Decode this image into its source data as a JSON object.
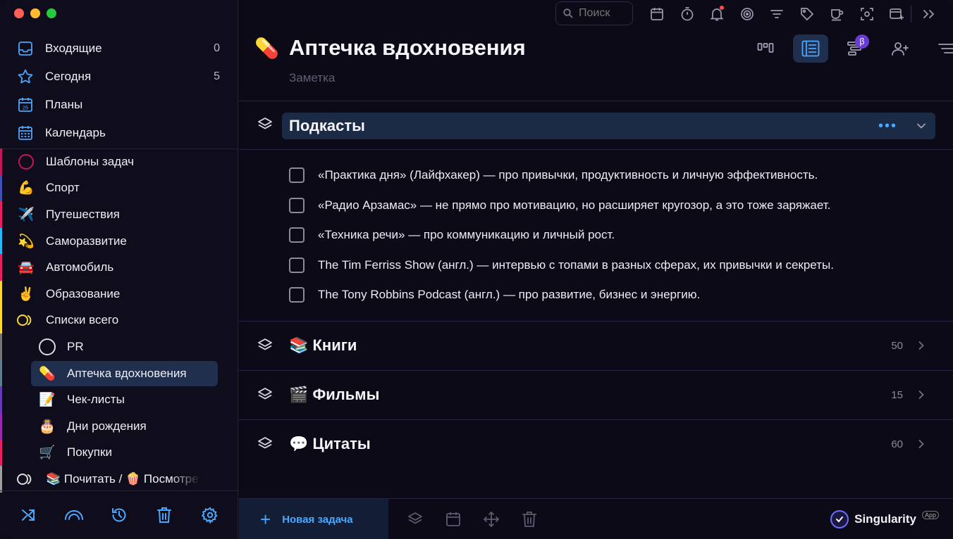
{
  "sidebar": {
    "nav": [
      {
        "label": "Входящие",
        "count": "0",
        "icon": "inbox-icon"
      },
      {
        "label": "Сегодня",
        "count": "5",
        "icon": "star-icon"
      },
      {
        "label": "Планы",
        "count": "",
        "icon": "calendar-25-icon"
      },
      {
        "label": "Календарь",
        "count": "",
        "icon": "calendar-grid-icon"
      }
    ],
    "projects": [
      {
        "label": "Шаблоны задач",
        "icon": "◯",
        "bar": "#c2185b"
      },
      {
        "label": "Спорт",
        "icon": "💪",
        "bar": "#3f51b5"
      },
      {
        "label": "Путешествия",
        "icon": "✈️",
        "bar": "#e91e63"
      },
      {
        "label": "Саморазвитие",
        "icon": "💫",
        "bar": "#29b6f6"
      },
      {
        "label": "Автомобиль",
        "icon": "🚘",
        "bar": "#e91e63"
      },
      {
        "label": "Образование",
        "icon": "✌️",
        "bar": "#fdd835"
      },
      {
        "label": "Списки всего",
        "icon": "◯",
        "bar": "#fdd835"
      },
      {
        "label": "PR",
        "icon": "◯",
        "bar": "#757575"
      },
      {
        "label": "Аптечка вдохновения",
        "icon": "💊",
        "bar": "#607d8b"
      },
      {
        "label": "Чек-листы",
        "icon": "📝",
        "bar": "#673ab7"
      },
      {
        "label": "Дни рождения",
        "icon": "🎂",
        "bar": "#9c27b0"
      },
      {
        "label": "Покупки",
        "icon": "🛒",
        "bar": "#e91e63"
      },
      {
        "label": "📚 Почитать / 🍿 Посмотреть",
        "icon": "◯",
        "bar": "#9e9e9e"
      }
    ]
  },
  "toolbar": {
    "search_placeholder": "Поиск"
  },
  "header": {
    "icon": "💊",
    "title": "Аптечка вдохновения",
    "subtitle": "Заметка",
    "beta": "β"
  },
  "sections": [
    {
      "title": "Подкасты",
      "tasks": [
        "«Практика дня» (Лайфхакер) — про привычки, продуктивность и личную эффективность.",
        "«Радио Арзамас» — не прямо про мотивацию, но расширяет кругозор, а это тоже заряжает.",
        "«Техника речи» — про коммуникацию и личный рост.",
        "The Tim Ferriss Show (англ.) — интервью с топами в разных сферах, их привычки и секреты.",
        "The Tony Robbins Podcast (англ.) — про развитие, бизнес и энергию."
      ]
    },
    {
      "title": "📚 Книги",
      "count": "50"
    },
    {
      "title": "🎬 Фильмы",
      "count": "15"
    },
    {
      "title": "💬 Цитаты",
      "count": "60"
    }
  ],
  "bottom": {
    "new_task": "Новая задача",
    "brand": "Singularity",
    "app_badge": "App"
  },
  "colors": {
    "accent": "#4aa8ff",
    "active_bg": "#1f2f4d",
    "background": "#0c0a17"
  }
}
